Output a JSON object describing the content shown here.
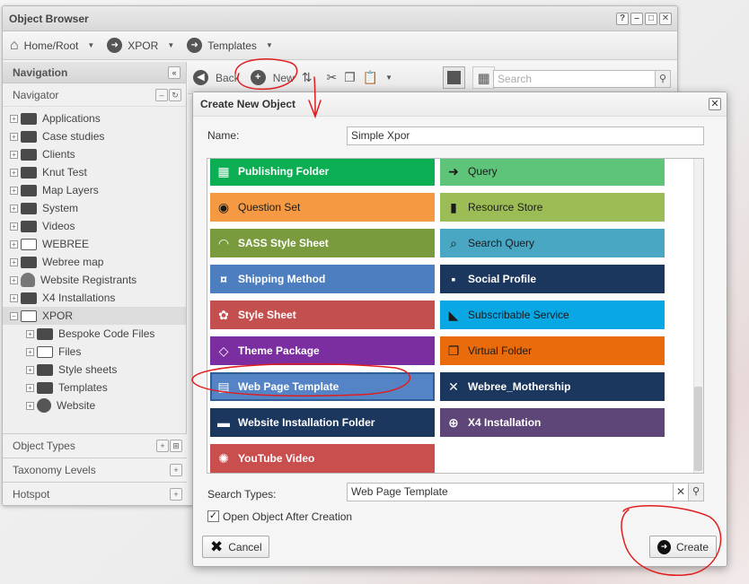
{
  "browser": {
    "title": "Object Browser",
    "window_buttons": [
      "?",
      "–",
      "□",
      "✕"
    ],
    "breadcrumbs": [
      "Home/Root",
      "XPOR",
      "Templates"
    ],
    "navigation_label": "Navigation",
    "navigator_label": "Navigator",
    "tree": [
      {
        "label": "Applications",
        "icon": "folder-icon",
        "level": 0
      },
      {
        "label": "Case studies",
        "icon": "folder-icon",
        "level": 0
      },
      {
        "label": "Clients",
        "icon": "folder-icon",
        "level": 0
      },
      {
        "label": "Knut Test",
        "icon": "folder-icon",
        "level": 0
      },
      {
        "label": "Map Layers",
        "icon": "folder-icon",
        "level": 0
      },
      {
        "label": "System",
        "icon": "folder-icon",
        "level": 0
      },
      {
        "label": "Videos",
        "icon": "folder-icon",
        "level": 0
      },
      {
        "label": "WEBREE",
        "icon": "webree-icon",
        "level": 0
      },
      {
        "label": "Webree map",
        "icon": "folder-icon",
        "level": 0
      },
      {
        "label": "Website Registrants",
        "icon": "people-icon",
        "level": 0
      },
      {
        "label": "X4 Installations",
        "icon": "folder-icon",
        "level": 0
      },
      {
        "label": "XPOR",
        "icon": "webree-icon",
        "level": 0,
        "selected": true,
        "expanded": true
      },
      {
        "label": "Bespoke Code Files",
        "icon": "folder-icon",
        "level": 1
      },
      {
        "label": "Files",
        "icon": "files-icon",
        "level": 1
      },
      {
        "label": "Style sheets",
        "icon": "folder-icon",
        "level": 1
      },
      {
        "label": "Templates",
        "icon": "folder-icon",
        "level": 1
      },
      {
        "label": "Website",
        "icon": "globe-icon",
        "level": 1
      }
    ],
    "sections": [
      "Object Types",
      "Taxonomy Levels",
      "Hotspot"
    ],
    "toolbar": {
      "back": "Back",
      "new": "New"
    },
    "search_placeholder": "Search"
  },
  "dialog": {
    "title": "Create New Object",
    "name_label": "Name:",
    "name_value": "Simple Xpor",
    "search_label": "Search Types:",
    "search_value": "Web Page Template",
    "checkbox_label": "Open Object After Creation",
    "checkbox_checked": true,
    "cancel_label": "Cancel",
    "create_label": "Create",
    "types": [
      {
        "label": "Publishing Folder",
        "color": "#0bae52",
        "icon": "calendar-icon",
        "glyph": "▦",
        "bold": true
      },
      {
        "label": "Query",
        "color": "#5ec479",
        "icon": "arrow-right-icon",
        "glyph": "➜",
        "bold": false,
        "dark": true
      },
      {
        "label": "Question Set",
        "color": "#f59a42",
        "icon": "fingerprint-icon",
        "glyph": "◉",
        "bold": false,
        "dark": true
      },
      {
        "label": "Resource Store",
        "color": "#9cbd55",
        "icon": "book-icon",
        "glyph": "▮",
        "bold": false,
        "dark": true
      },
      {
        "label": "SASS Style Sheet",
        "color": "#7a9a3e",
        "icon": "rainbow-icon",
        "glyph": "◠",
        "bold": true
      },
      {
        "label": "Search Query",
        "color": "#4aa7c4",
        "icon": "search-query-icon",
        "glyph": "⌕",
        "bold": false,
        "dark": true
      },
      {
        "label": "Shipping Method",
        "color": "#4d7fc0",
        "icon": "shipping-icon",
        "glyph": "¤",
        "bold": true
      },
      {
        "label": "Social Profile",
        "color": "#1c375e",
        "icon": "person-icon",
        "glyph": "▪",
        "bold": true
      },
      {
        "label": "Style Sheet",
        "color": "#c44f4f",
        "icon": "palette-icon",
        "glyph": "✿",
        "bold": true
      },
      {
        "label": "Subscribable Service",
        "color": "#09a7e3",
        "icon": "rss-icon",
        "glyph": "◣",
        "bold": false,
        "dark": true
      },
      {
        "label": "Theme Package",
        "color": "#7b2ea0",
        "icon": "theme-icon",
        "glyph": "◇",
        "bold": true
      },
      {
        "label": "Virtual Folder",
        "color": "#ea6b0c",
        "icon": "copy-icon",
        "glyph": "❐",
        "bold": false,
        "dark": true
      },
      {
        "label": "Web Page Template",
        "color": "#5584c6",
        "icon": "template-icon",
        "glyph": "▤",
        "bold": true,
        "selected": true
      },
      {
        "label": "Webree_Mothership",
        "color": "#1c375e",
        "icon": "mothership-icon",
        "glyph": "✕",
        "bold": true
      },
      {
        "label": "Website Installation Folder",
        "color": "#1c375e",
        "icon": "installer-icon",
        "glyph": "▬",
        "bold": true
      },
      {
        "label": "X4 Installation",
        "color": "#5e4678",
        "icon": "x4-icon",
        "glyph": "⊕",
        "bold": true
      },
      {
        "label": "YouTube Video",
        "color": "#c94e4e",
        "icon": "youtube-icon",
        "glyph": "✺",
        "bold": true
      }
    ]
  }
}
